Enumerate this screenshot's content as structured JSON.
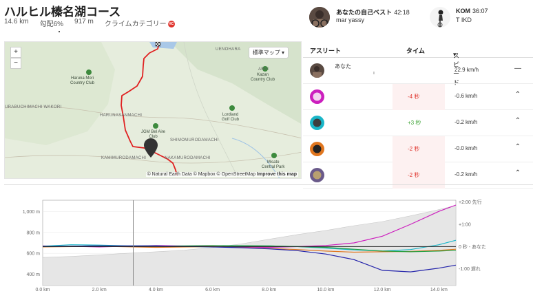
{
  "segment": {
    "title": "ハルヒル榛名湖コース",
    "distance": "14.6 km",
    "grade": "勾配6%",
    "elevation": "917 m",
    "category_label": "クライムカテゴリー",
    "category_badge": "HC"
  },
  "personal_best": {
    "label": "あなたの自己ベスト",
    "time": "42:18",
    "user": "mar yassy"
  },
  "kom": {
    "label": "KOM",
    "time": "36:07",
    "user": "T IKD"
  },
  "map": {
    "zoom_in": "+",
    "zoom_out": "−",
    "map_type": "標準マップ",
    "map_type_caret": "▾",
    "attribution_prefix": "© Natural Earth Data © Mapbox © OpenStreetMap",
    "attribution_link": "Improve this map",
    "places": {
      "haruna_mori": "Haruna Mori\nCountry Club",
      "kazan": "Kazan\nCountry Club",
      "lordland": "Lordland\nGolf Club",
      "jgm": "JGM Bel Aire\nClub",
      "misato": "Misato\nCentral Park",
      "uenohara": "UENOHARA",
      "arai": "ARAI",
      "harunasanmachi": "HARUNASANMACHI",
      "kuraobuchi": "URABUCHIMACHI WAKORI",
      "shimomuroda": "SHIMOMURODAMACHI",
      "kamimuroda": "KAMIMURODAMACHI",
      "nakamuroda": "NAKAMURODAMACHI"
    }
  },
  "leaderboard": {
    "headers": {
      "athlete": "アスリート",
      "time": "タイム",
      "speed": "スピード",
      "speed_caret": "▾"
    },
    "rows": [
      {
        "name": "あなた",
        "sub": "ı",
        "diff": "",
        "speed": "22.9 km/h",
        "action": "—"
      },
      {
        "name": "",
        "sub": "",
        "diff": "-4 秒",
        "speed": "-0.6 km/h",
        "action": "⌃"
      },
      {
        "name": "",
        "sub": "",
        "diff": "+3 秒",
        "speed": "-0.2 km/h",
        "action": "⌃"
      },
      {
        "name": "",
        "sub": "",
        "diff": "-2 秒",
        "speed": "-0.0 km/h",
        "action": "⌃"
      },
      {
        "name": "",
        "sub": "",
        "diff": "-2 秒",
        "speed": "-0.2 km/h",
        "action": "⌃"
      }
    ]
  },
  "chart_data": {
    "type": "line",
    "x_ticks": [
      "0.0 km",
      "2.0 km",
      "4.0 km",
      "6.0 km",
      "8.0 km",
      "10.0 km",
      "12.0 km",
      "14.0 km"
    ],
    "xlim": [
      0,
      14.6
    ],
    "left_ticks": [
      "1,000 m",
      "800 m",
      "600 m",
      "400 m"
    ],
    "left_tick_values": [
      1000,
      800,
      600,
      400
    ],
    "ylim_elevation": [
      290,
      1110
    ],
    "right_ticks": [
      "+2:00 先行",
      "+1:00",
      "0 秒 - あなた",
      "-1:00 遅れ"
    ],
    "right_tick_values": [
      120,
      60,
      0,
      -60
    ],
    "ylim_gap_seconds": [
      -105,
      125
    ],
    "cursor_km": 3.2,
    "elevation_profile": {
      "x": [
        0,
        1,
        2,
        3,
        4,
        5,
        6,
        7,
        8,
        9,
        10,
        11,
        12,
        13,
        14,
        14.6
      ],
      "y": [
        560,
        570,
        585,
        600,
        615,
        630,
        655,
        690,
        735,
        780,
        820,
        865,
        905,
        960,
        1020,
        1060
      ]
    },
    "series": [
      {
        "color": "#cc1fbe",
        "x": [
          0,
          2,
          4,
          6,
          8,
          9,
          10,
          11,
          12,
          13,
          14,
          14.6
        ],
        "y": [
          2,
          -1,
          3,
          0,
          -2,
          0,
          3,
          10,
          28,
          60,
          95,
          112
        ]
      },
      {
        "color": "#1ab6c8",
        "x": [
          0,
          1,
          2,
          3,
          4,
          5,
          6,
          7,
          8,
          9,
          10,
          11,
          12,
          13,
          14,
          14.6
        ],
        "y": [
          1,
          5,
          4,
          2,
          2,
          0,
          -1,
          1,
          2,
          0,
          -4,
          -9,
          -12,
          -8,
          5,
          17
        ]
      },
      {
        "color": "#e0761f",
        "x": [
          0,
          2,
          4,
          6,
          8,
          9,
          10,
          11,
          12,
          13,
          14,
          14.6
        ],
        "y": [
          -1,
          1,
          -2,
          0,
          -5,
          -8,
          -12,
          -15,
          -14,
          -13,
          -10,
          -7
        ]
      },
      {
        "color": "#27a043",
        "x": [
          0,
          2,
          4,
          6,
          8,
          10,
          12,
          13,
          14,
          14.6
        ],
        "y": [
          0,
          2,
          1,
          3,
          2,
          -2,
          -12,
          -14,
          -12,
          -10
        ]
      },
      {
        "color": "#2222aa",
        "x": [
          0,
          2,
          4,
          6,
          7,
          8,
          9,
          10,
          11,
          12,
          13,
          14,
          14.6
        ],
        "y": [
          0,
          2,
          2,
          -1,
          -3,
          -6,
          -11,
          -20,
          -35,
          -64,
          -68,
          -58,
          -50
        ]
      },
      {
        "color": "#222222",
        "x": [
          0,
          14.6
        ],
        "y": [
          0,
          0
        ]
      }
    ]
  }
}
